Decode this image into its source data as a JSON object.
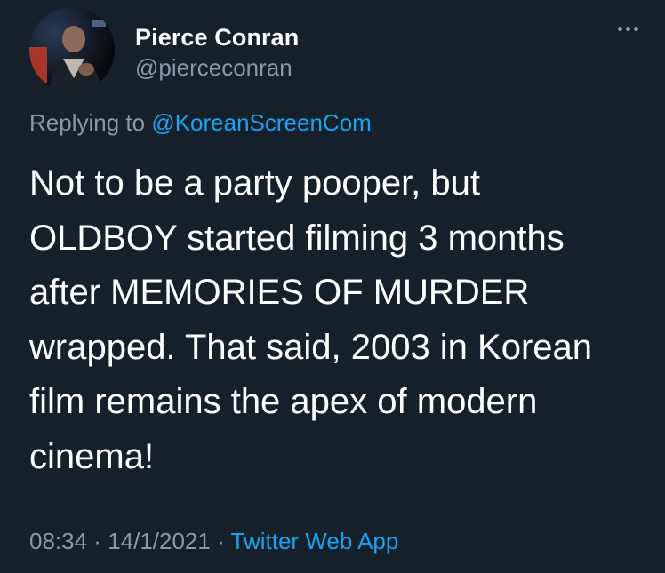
{
  "author": {
    "display_name": "Pierce Conran",
    "handle": "@pierceconran",
    "avatar_icon": "profile-photo"
  },
  "more_icon": "more-options-icon",
  "reply": {
    "prefix": "Replying to",
    "mention": "@KoreanScreenCom"
  },
  "tweet": {
    "lines": [
      "Not to be a party pooper, but",
      "OLDBOY started filming 3 months",
      "after MEMORIES OF MURDER",
      "wrapped. That said, 2003 in Korean",
      "film remains the apex of modern",
      "cinema!"
    ]
  },
  "meta": {
    "time": "08:34",
    "sep1": " · ",
    "date": "14/1/2021",
    "sep2": " · ",
    "source": "Twitter Web App"
  },
  "colors": {
    "background": "#15202b",
    "text": "#ffffff",
    "muted": "#8899a6",
    "link": "#1da1f2"
  }
}
